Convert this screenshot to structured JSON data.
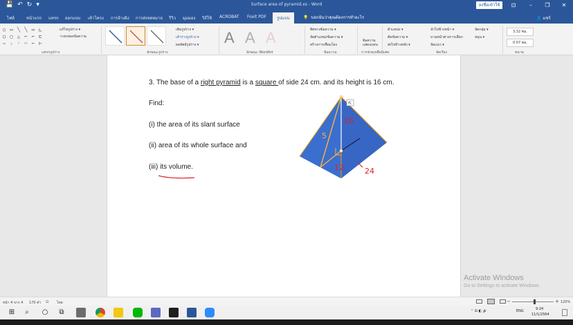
{
  "window": {
    "title": "Surface area of pyramid.xs - Word",
    "signin_label": "ลงชื่อเข้าใช้",
    "min_glyph": "–",
    "restore_glyph": "❐",
    "close_glyph": "✕",
    "ribbon_opts_glyph": "⊡"
  },
  "qat": {
    "save": "💾",
    "undo": "↶",
    "redo": "↻",
    "customize": "▾"
  },
  "tabs": [
    "ไฟล์",
    "หน้าแรก",
    "แทรก",
    "ออกแบบ",
    "เค้าโครง",
    "การอ้างอิง",
    "การส่งจดหมาย",
    "รีวิว",
    "มุมมอง",
    "วิธีใช้",
    "ACROBAT",
    "Foxit PDF",
    "รูปแบบ"
  ],
  "active_tab_index": 12,
  "tellme": {
    "icon": "💡",
    "text": "บอกฉันว่าคุณต้องการทำอะไร"
  },
  "share": {
    "icon": "👤",
    "label": "แชร์"
  },
  "ribbon": {
    "groups": [
      {
        "label": "แทรกรูปร่าง"
      },
      {
        "label": "ลักษณะรูปร่าง"
      },
      {
        "label": "ลักษณะ WordArt"
      },
      {
        "label": "ข้อความ"
      },
      {
        "label": "การช่วยเหลือพิเศษ"
      },
      {
        "label": "จัดเรียง"
      },
      {
        "label": "ขนาด"
      }
    ],
    "shape_glyphs": "○ ▭ ╲ ╲ ▭ ◺\n◯ ▢ △ ⌐ ⌐ ⊏\n⇨ ☆ ◜ ⌒ ⌐ ⊢",
    "edit_shape": "แก้ไขรูปร่าง ▾",
    "draw_textbox": "วาดกล่องข้อความ",
    "fill_label": "เติมรูปร่าง ▾",
    "outline_label": "เค้าร่างรูปร่าง ▾",
    "effect_label": "ผลลัพธ์รูปร่าง ▾",
    "text_fill_glyph": "A",
    "text_direction": "ทิศทางข้อความ ▾",
    "align_text": "จัดตำแหน่งข้อความ ▾",
    "create_link": "สร้างการเชื่อมโยง",
    "alt_text": "ข้อความ แสดงแทน",
    "position": "ตำแหน่ง ▾",
    "wrap_text": "ตัดข้อความ ▾",
    "bring_forward": "นำไปข้างหน้า ▾",
    "send_backward": "ส่งไปข้างหลัง ▾",
    "selection_pane": "บานหน้าต่างการเลือก",
    "align": "จัดแนว ▾",
    "group": "จัดกลุ่ม ▾",
    "rotate": "หมุน ▾",
    "height": "3.32 ซม.",
    "width": "0.07 ซม."
  },
  "document": {
    "question": {
      "pre": "3. The base of a ",
      "u1": "right pyramid",
      "mid": " is a ",
      "u2": "square ",
      "post": "of side 24 cm. and its height is 16 cm."
    },
    "find": "Find:",
    "item1": "(i) the area of its slant surface",
    "item2": "(ii) area of its whole surface and",
    "item3": "(iii) its volume."
  },
  "annotations": {
    "height": "16",
    "slant": "5",
    "half_side": "12",
    "side": "24",
    "tag": "⇱"
  },
  "watermark": {
    "line1": "Activate Windows",
    "line2": "Go to Settings to activate Windows."
  },
  "status": {
    "page": "หน้า 4 จาก 4",
    "words": "170 คำ",
    "proof_icon": "⊡",
    "language": "ไทย",
    "zoom": "120%",
    "zoom_minus": "−",
    "zoom_plus": "+"
  },
  "taskbar": {
    "start": "⊞",
    "search": "⌕",
    "cortana": "○",
    "taskview": "⧉",
    "tray_lang": "ENG",
    "time": "9:24",
    "date": "11/1/2564",
    "tray_icons": "⌃ ⊟ ◧ 🔊"
  },
  "colors": {
    "word_blue": "#2b579a",
    "pyramid_blue": "#3a6fd0",
    "pyramid_edge": "#ffb238",
    "annotation_red": "#e02020"
  }
}
